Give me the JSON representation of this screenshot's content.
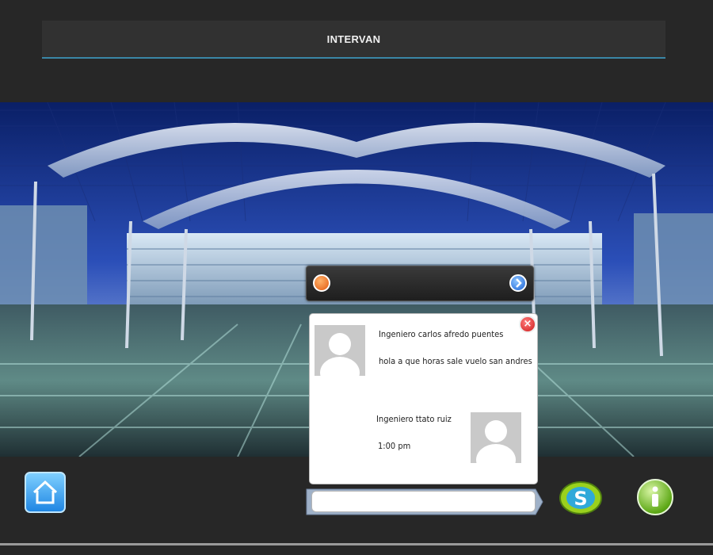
{
  "header": {
    "title": "INTERVAN"
  },
  "chat": {
    "incoming": {
      "sender": "Ingeniero carlos afredo puentes",
      "text": "hola a que horas sale vuelo san andres"
    },
    "outgoing": {
      "sender": "Ingeniero ttato ruiz",
      "time": "1:00 pm"
    },
    "input": {
      "value": "",
      "placeholder": ""
    }
  },
  "icons": {
    "user": "user-icon",
    "next": "chevron-right-icon",
    "close": "close-icon",
    "home": "home-icon",
    "skype": "skype-icon",
    "info": "info-icon"
  },
  "colors": {
    "background": "#272727",
    "header_underline": "#3a86a6",
    "chat_background": "#ffffff"
  }
}
